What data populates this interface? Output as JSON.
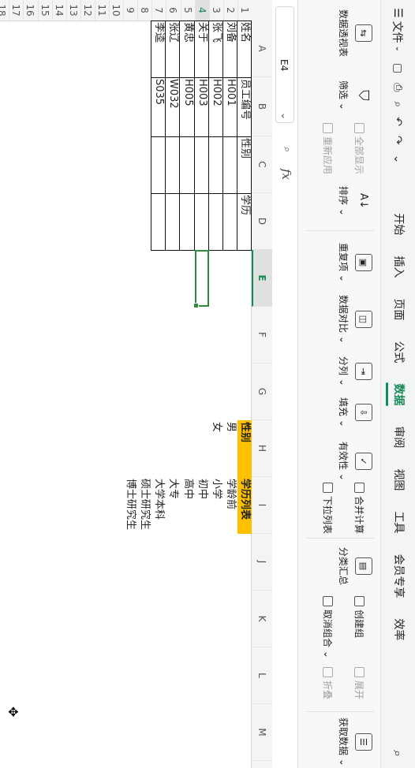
{
  "menubar": {
    "file_label": "文件",
    "tabs": [
      "开始",
      "插入",
      "页面",
      "公式",
      "数据",
      "审阅",
      "视图",
      "工具",
      "会员专享",
      "效率"
    ],
    "active_tab": "数据"
  },
  "ribbon": {
    "pivot": "数据透视表",
    "filter": "筛选",
    "show_all": "全部显示",
    "reapply": "重新应用",
    "sort": "排序",
    "duplicates": "重复项",
    "compare": "数据对比",
    "split": "分列",
    "fill": "填充",
    "validity": "有效性",
    "consolidate": "合并计算",
    "dropdown_list": "下拉列表",
    "subtotal": "分类汇总",
    "create_group": "创建组",
    "ungroup": "取消组合",
    "expand": "展开",
    "collapse": "折叠",
    "get_data": "获取数据"
  },
  "formula_bar": {
    "name_box": "E4",
    "fx_label": "fx",
    "value": ""
  },
  "sheet": {
    "columns": [
      "A",
      "B",
      "C",
      "D",
      "E",
      "F",
      "G",
      "H",
      "I",
      "J",
      "K",
      "L",
      "M"
    ],
    "selected_column": "E",
    "rows": [
      "1",
      "2",
      "3",
      "4",
      "5",
      "6",
      "7",
      "8",
      "9",
      "10",
      "11",
      "12",
      "13",
      "14",
      "15",
      "16",
      "17",
      "18",
      "19"
    ],
    "selected_row": "4",
    "table_headers": [
      "姓名",
      "员工编号",
      "性别",
      "学历"
    ],
    "table_rows": [
      [
        "刘备",
        "H001"
      ],
      [
        "张飞",
        "H002"
      ],
      [
        "关于",
        "H003"
      ],
      [
        "黄忠",
        "H005"
      ],
      [
        "张辽",
        "W032"
      ],
      [
        "李逵",
        "S035"
      ]
    ],
    "gender_list_header": "性别",
    "gender_list": [
      "男",
      "女"
    ],
    "edu_list_header": "学历列表",
    "edu_list": [
      "学龄前",
      "小学",
      "初中",
      "高中",
      "大专",
      "大学本科",
      "硕士研究生",
      "博士研究生"
    ]
  },
  "colors": {
    "accent": "#168a55",
    "header_fill": "#ffc000",
    "selection": "#2f8a3a"
  }
}
